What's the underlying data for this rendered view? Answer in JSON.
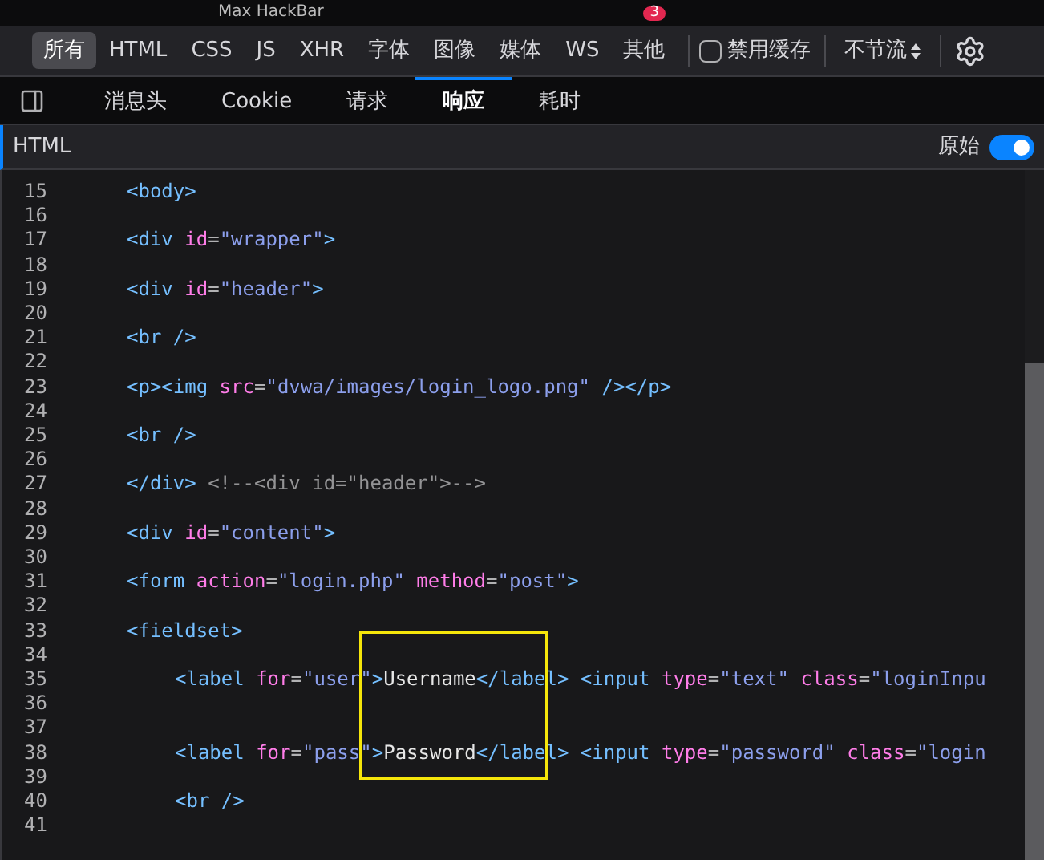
{
  "window": {
    "title": "Max HackBar",
    "badge": "3"
  },
  "filters": [
    {
      "label": "所有",
      "selected": true
    },
    {
      "label": "HTML",
      "selected": false
    },
    {
      "label": "CSS",
      "selected": false
    },
    {
      "label": "JS",
      "selected": false
    },
    {
      "label": "XHR",
      "selected": false
    },
    {
      "label": "字体",
      "selected": false
    },
    {
      "label": "图像",
      "selected": false
    },
    {
      "label": "媒体",
      "selected": false
    },
    {
      "label": "WS",
      "selected": false
    },
    {
      "label": "其他",
      "selected": false
    }
  ],
  "disable_cache": {
    "label": "禁用缓存",
    "checked": false
  },
  "throttle": {
    "value": "不节流"
  },
  "tabs": [
    {
      "label": "消息头",
      "selected": false
    },
    {
      "label": "Cookie",
      "selected": false
    },
    {
      "label": "请求",
      "selected": false
    },
    {
      "label": "响应",
      "selected": true
    },
    {
      "label": "耗时",
      "selected": false
    }
  ],
  "response_header": {
    "title": "HTML",
    "raw_label": "原始",
    "raw_on": true
  },
  "code": [
    {
      "n": "15",
      "tokens": [
        {
          "kind": "tag",
          "t": "<body>"
        }
      ]
    },
    {
      "n": "16"
    },
    {
      "n": "17",
      "tokens": [
        {
          "kind": "tag",
          "t": "<div "
        },
        {
          "kind": "attr",
          "t": "id"
        },
        {
          "kind": "eq",
          "t": "="
        },
        {
          "kind": "str",
          "t": "\"wrapper\""
        },
        {
          "kind": "tag",
          "t": ">"
        }
      ]
    },
    {
      "n": "18"
    },
    {
      "n": "19",
      "tokens": [
        {
          "kind": "tag",
          "t": "<div "
        },
        {
          "kind": "attr",
          "t": "id"
        },
        {
          "kind": "eq",
          "t": "="
        },
        {
          "kind": "str",
          "t": "\"header\""
        },
        {
          "kind": "tag",
          "t": ">"
        }
      ]
    },
    {
      "n": "20"
    },
    {
      "n": "21",
      "tokens": [
        {
          "kind": "tag",
          "t": "<br />"
        }
      ]
    },
    {
      "n": "22"
    },
    {
      "n": "23",
      "tokens": [
        {
          "kind": "tag",
          "t": "<p><img "
        },
        {
          "kind": "attr",
          "t": "src"
        },
        {
          "kind": "eq",
          "t": "="
        },
        {
          "kind": "str",
          "t": "\"dvwa/images/login_logo.png\""
        },
        {
          "kind": "tag",
          "t": " /></p>"
        }
      ]
    },
    {
      "n": "24"
    },
    {
      "n": "25",
      "tokens": [
        {
          "kind": "tag",
          "t": "<br />"
        }
      ]
    },
    {
      "n": "26"
    },
    {
      "n": "27",
      "tokens": [
        {
          "kind": "tag",
          "t": "</div> "
        },
        {
          "kind": "comment",
          "t": "<!--<div id=\"header\">-->"
        }
      ]
    },
    {
      "n": "28"
    },
    {
      "n": "29",
      "tokens": [
        {
          "kind": "tag",
          "t": "<div "
        },
        {
          "kind": "attr",
          "t": "id"
        },
        {
          "kind": "eq",
          "t": "="
        },
        {
          "kind": "str",
          "t": "\"content\""
        },
        {
          "kind": "tag",
          "t": ">"
        }
      ]
    },
    {
      "n": "30"
    },
    {
      "n": "31",
      "tokens": [
        {
          "kind": "tag",
          "t": "<form "
        },
        {
          "kind": "attr",
          "t": "action"
        },
        {
          "kind": "eq",
          "t": "="
        },
        {
          "kind": "str",
          "t": "\"login.php\" "
        },
        {
          "kind": "attr",
          "t": "method"
        },
        {
          "kind": "eq",
          "t": "="
        },
        {
          "kind": "str",
          "t": "\"post\""
        },
        {
          "kind": "tag",
          "t": ">"
        }
      ]
    },
    {
      "n": "32"
    },
    {
      "n": "33",
      "tokens": [
        {
          "kind": "tag",
          "t": "<fieldset>"
        }
      ],
      "children": [
        {
          "n": "34"
        },
        {
          "n": "35",
          "tokens": [
            {
              "kind": "tag",
              "t": "<label "
            },
            {
              "kind": "attr",
              "t": "for"
            },
            {
              "kind": "eq",
              "t": "="
            },
            {
              "kind": "str",
              "t": "\"user\""
            },
            {
              "kind": "tag",
              "t": ">"
            },
            {
              "kind": "text",
              "t": "Username"
            },
            {
              "kind": "tag",
              "t": "</label> <input "
            },
            {
              "kind": "attr",
              "t": "type"
            },
            {
              "kind": "eq",
              "t": "="
            },
            {
              "kind": "str",
              "t": "\"text\" "
            },
            {
              "kind": "attr",
              "t": "class"
            },
            {
              "kind": "eq",
              "t": "="
            },
            {
              "kind": "str",
              "t": "\"loginInpu"
            }
          ]
        },
        {
          "n": "36"
        },
        {
          "n": "37"
        },
        {
          "n": "38",
          "tokens": [
            {
              "kind": "tag",
              "t": "<label "
            },
            {
              "kind": "attr",
              "t": "for"
            },
            {
              "kind": "eq",
              "t": "="
            },
            {
              "kind": "str",
              "t": "\"pass\""
            },
            {
              "kind": "tag",
              "t": ">"
            },
            {
              "kind": "text",
              "t": "Password"
            },
            {
              "kind": "tag",
              "t": "</label> <input "
            },
            {
              "kind": "attr",
              "t": "type"
            },
            {
              "kind": "eq",
              "t": "="
            },
            {
              "kind": "str",
              "t": "\"password\" "
            },
            {
              "kind": "attr",
              "t": "class"
            },
            {
              "kind": "eq",
              "t": "="
            },
            {
              "kind": "str",
              "t": "\"login"
            }
          ]
        },
        {
          "n": "39"
        },
        {
          "n": "40",
          "tokens": [
            {
              "kind": "tag",
              "t": "<br />"
            }
          ]
        },
        {
          "n": "41"
        }
      ]
    }
  ],
  "highlight": {
    "kind": "rectangle"
  }
}
